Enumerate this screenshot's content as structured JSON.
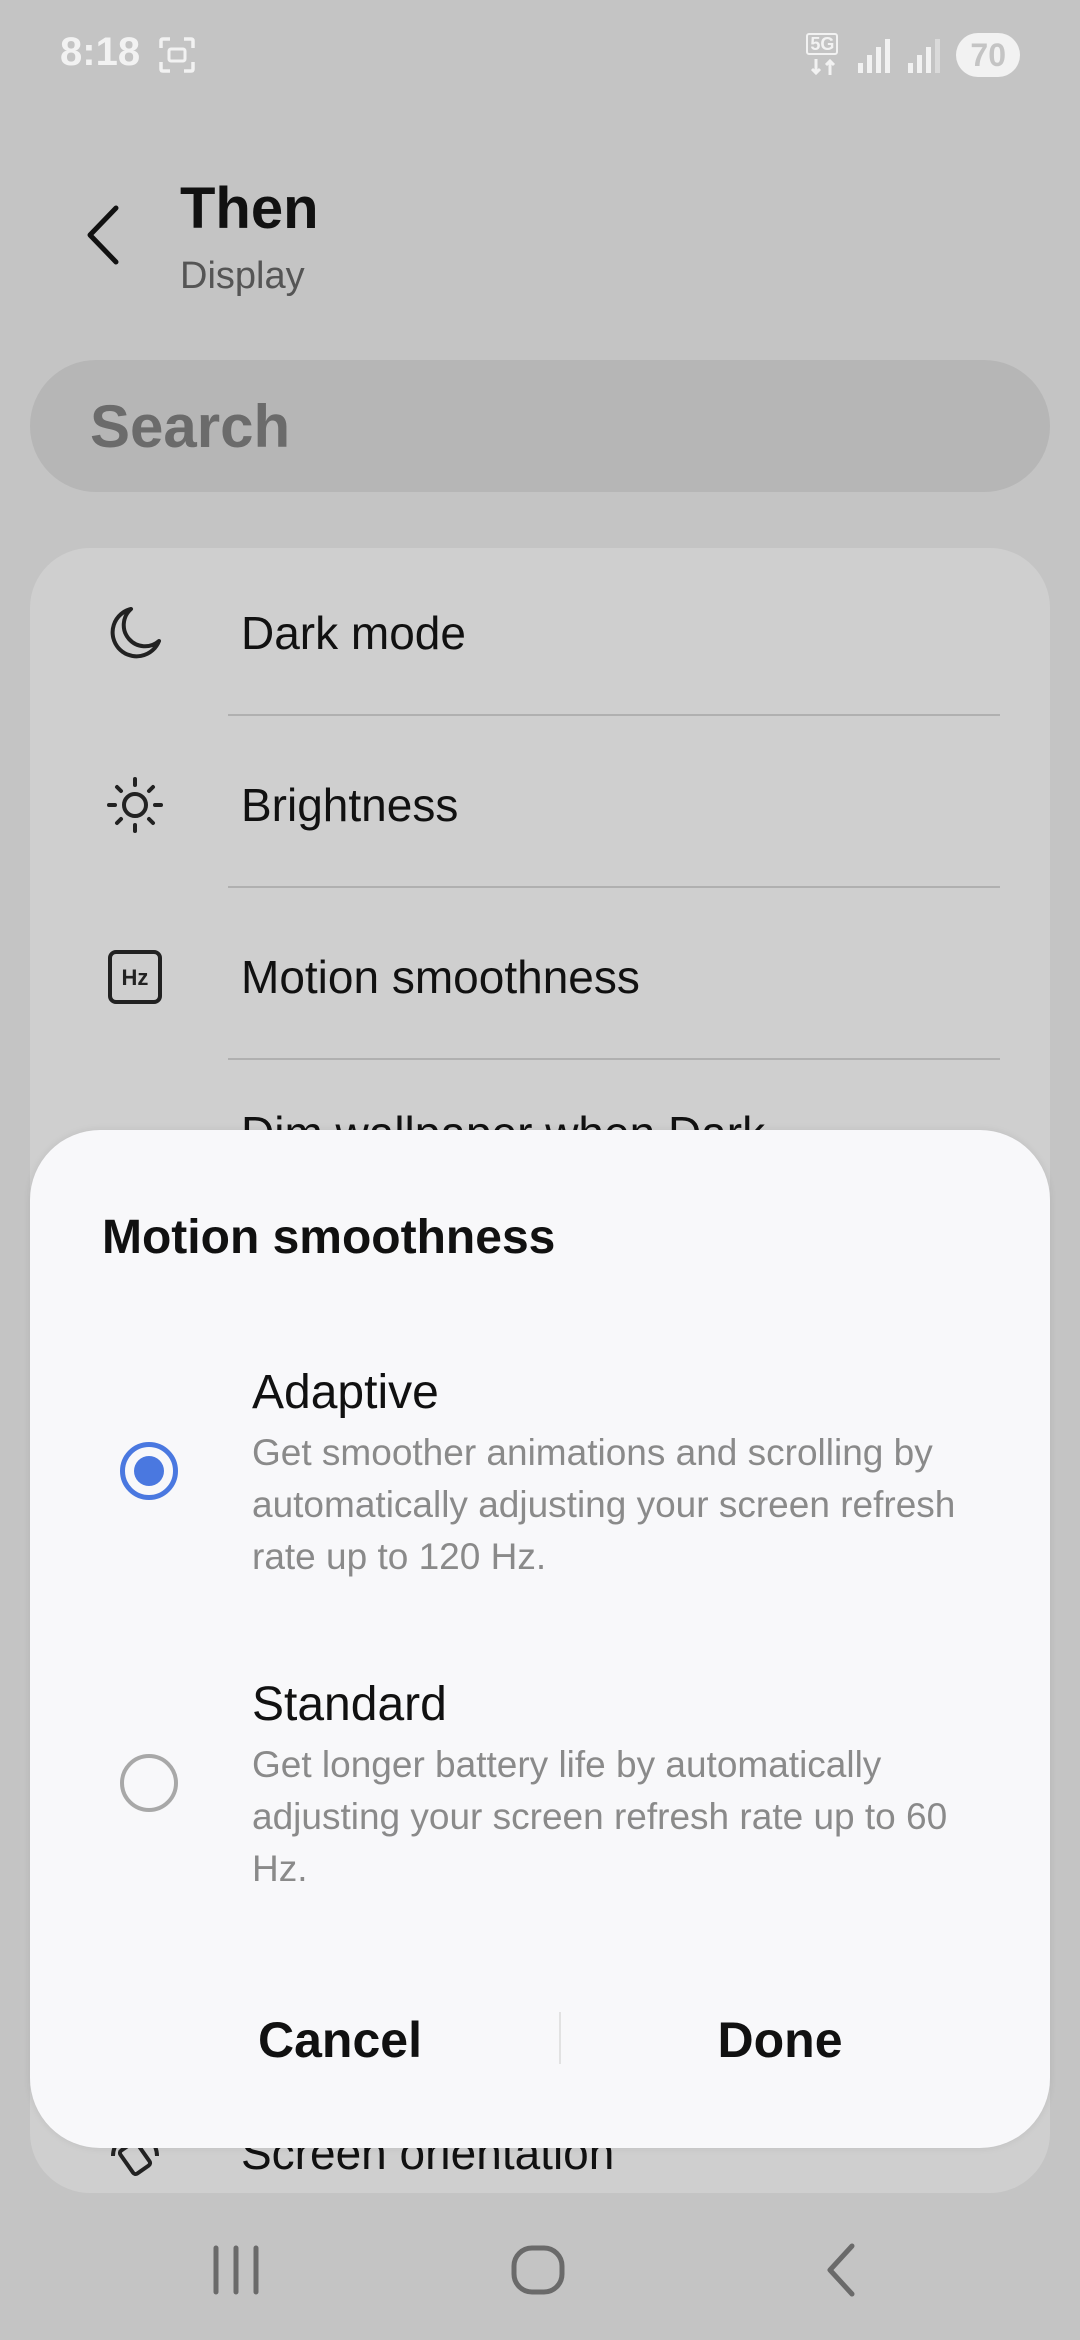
{
  "status_bar": {
    "time": "8:18",
    "network": "5G",
    "battery": "70"
  },
  "header": {
    "title": "Then",
    "subtitle": "Display"
  },
  "search": {
    "placeholder": "Search"
  },
  "settings": {
    "items": [
      {
        "label": "Dark mode",
        "icon": "moon-icon"
      },
      {
        "label": "Brightness",
        "icon": "sun-icon"
      },
      {
        "label": "Motion smoothness",
        "icon": "hz-icon"
      },
      {
        "label": "Dim wallpaper when Dark",
        "icon": "wallpaper-icon"
      },
      {
        "label": "Screen orientation",
        "icon": "rotate-icon"
      }
    ]
  },
  "dialog": {
    "title": "Motion smoothness",
    "options": [
      {
        "title": "Adaptive",
        "description": "Get smoother animations and scrolling by automatically adjusting your screen refresh rate up to 120 Hz.",
        "selected": true
      },
      {
        "title": "Standard",
        "description": "Get longer battery life by automatically adjusting your screen refresh rate up to 60 Hz.",
        "selected": false
      }
    ],
    "cancel_label": "Cancel",
    "done_label": "Done",
    "accent_color": "#4a78e0"
  },
  "nav_bar": {
    "icons": [
      "recents-icon",
      "home-icon",
      "back-icon"
    ]
  }
}
